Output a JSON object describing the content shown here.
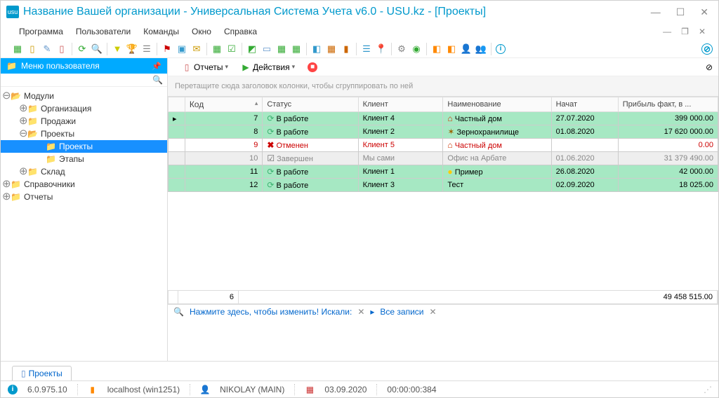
{
  "window": {
    "title": "Название Вашей организации - Универсальная Система Учета v6.0 - USU.kz - [Проекты]",
    "logo_text": "usu"
  },
  "menu": {
    "items": [
      "Программа",
      "Пользователи",
      "Команды",
      "Окно",
      "Справка"
    ]
  },
  "sidebar": {
    "header": "Меню пользователя",
    "tree": [
      {
        "label": "Модули",
        "lvl": 0,
        "exp": "⊖",
        "open": true
      },
      {
        "label": "Организация",
        "lvl": 1,
        "exp": "⊕"
      },
      {
        "label": "Продажи",
        "lvl": 1,
        "exp": "⊕"
      },
      {
        "label": "Проекты",
        "lvl": 1,
        "exp": "⊖",
        "open": true
      },
      {
        "label": "Проекты",
        "lvl": 2,
        "sel": true
      },
      {
        "label": "Этапы",
        "lvl": 2
      },
      {
        "label": "Склад",
        "lvl": 1,
        "exp": "⊕"
      },
      {
        "label": "Справочники",
        "lvl": 0,
        "exp": "⊕"
      },
      {
        "label": "Отчеты",
        "lvl": 0,
        "exp": "⊕"
      }
    ]
  },
  "content_toolbar": {
    "reports": "Отчеты",
    "actions": "Действия"
  },
  "group_hint": "Перетащите сюда заголовок колонки, чтобы сгруппировать по ней",
  "columns": [
    "Код",
    "Статус",
    "Клиент",
    "Наименование",
    "Начат",
    "Прибыль факт, в ..."
  ],
  "rows": [
    {
      "cls": "green",
      "code": "7",
      "st_icon": "⟳",
      "st_cls": "st-working",
      "status": "В работе",
      "client": "Клиент 4",
      "nm_icon": "⌂",
      "nm_cls": "nm-house",
      "name": "Частный дом",
      "date": "27.07.2020",
      "profit": "399 000.00"
    },
    {
      "cls": "green",
      "code": "8",
      "st_icon": "⟳",
      "st_cls": "st-working",
      "status": "В работе",
      "client": "Клиент 2",
      "nm_icon": "✶",
      "nm_cls": "nm-grain",
      "name": "Зернохранилище",
      "date": "01.08.2020",
      "profit": "17 620 000.00"
    },
    {
      "cls": "red",
      "code": "9",
      "st_icon": "✖",
      "st_cls": "st-cancel",
      "status": "Отменен",
      "client": "Клиент 5",
      "nm_icon": "⌂",
      "nm_cls": "nm-house",
      "name": "Частный дом",
      "date": "",
      "profit": "0.00"
    },
    {
      "cls": "gray",
      "code": "10",
      "st_icon": "☑",
      "st_cls": "st-done",
      "status": "Завершен",
      "client": "Мы сами",
      "nm_icon": "",
      "nm_cls": "",
      "name": "Офис на Арбате",
      "date": "01.06.2020",
      "profit": "31 379 490.00"
    },
    {
      "cls": "green",
      "code": "11",
      "st_icon": "⟳",
      "st_cls": "st-working",
      "status": "В работе",
      "client": "Клиент 1",
      "nm_icon": "●",
      "nm_cls": "nm-bulb",
      "name": "Пример",
      "date": "26.08.2020",
      "profit": "42 000.00"
    },
    {
      "cls": "green",
      "code": "12",
      "st_icon": "⟳",
      "st_cls": "st-working",
      "status": "В работе",
      "client": "Клиент 3",
      "nm_icon": "",
      "nm_cls": "",
      "name": "Тест",
      "date": "02.09.2020",
      "profit": "18 025.00"
    }
  ],
  "footer": {
    "count": "6",
    "total": "49 458 515.00"
  },
  "filter": {
    "hint": "Нажмите здесь, чтобы изменить! Искали:",
    "all": "Все записи"
  },
  "doctab": "Проекты",
  "status": {
    "version": "6.0.975.10",
    "host": "localhost (win1251)",
    "user": "NIKOLAY (MAIN)",
    "date": "03.09.2020",
    "time": "00:00:00:384"
  }
}
